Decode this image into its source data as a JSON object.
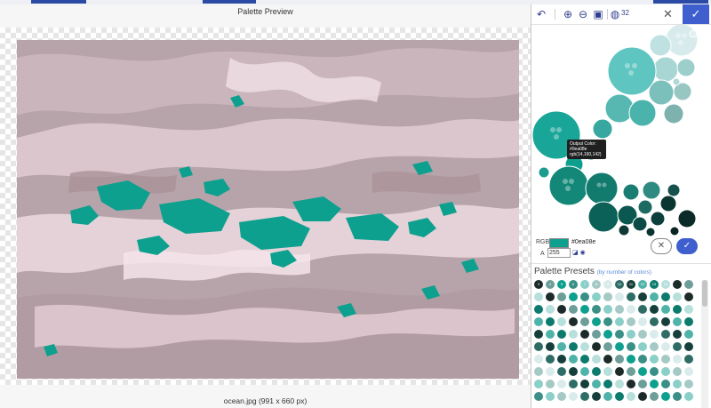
{
  "window": {
    "title": "Palette Preview",
    "caption": "ocean.jpg (991 x 660 px)"
  },
  "toolbar": {
    "undo_icon": "undo-icon",
    "zoom_in_icon": "zoom-in-icon",
    "zoom_out_icon": "zoom-out-icon",
    "fit_icon": "fit-image-icon",
    "palette_icon": "palette-icon",
    "color_count": "32",
    "close_icon": "close-icon",
    "confirm_icon": "check-icon"
  },
  "tooltip": {
    "line1": "Output Color:",
    "line2": "#0ea08e",
    "line3": "rgb(14,160,142)"
  },
  "color": {
    "rgb_label": "RGB",
    "hex": "#0ea08e",
    "swatch": "#0ea08e",
    "alpha_label": "A",
    "alpha_value": "255"
  },
  "presets": {
    "title": "Palette Presets",
    "subtitle": "(by number of colors)",
    "first_row": [
      "3",
      "4",
      "5",
      "6",
      "7",
      "8",
      "9",
      "10",
      "11",
      "12",
      "13",
      "14"
    ]
  },
  "colors": {
    "teal": "#0ea08e",
    "accent": "#3f5fcf",
    "image_base": "#b9a5ab",
    "image_light": "#e8d6dc"
  }
}
